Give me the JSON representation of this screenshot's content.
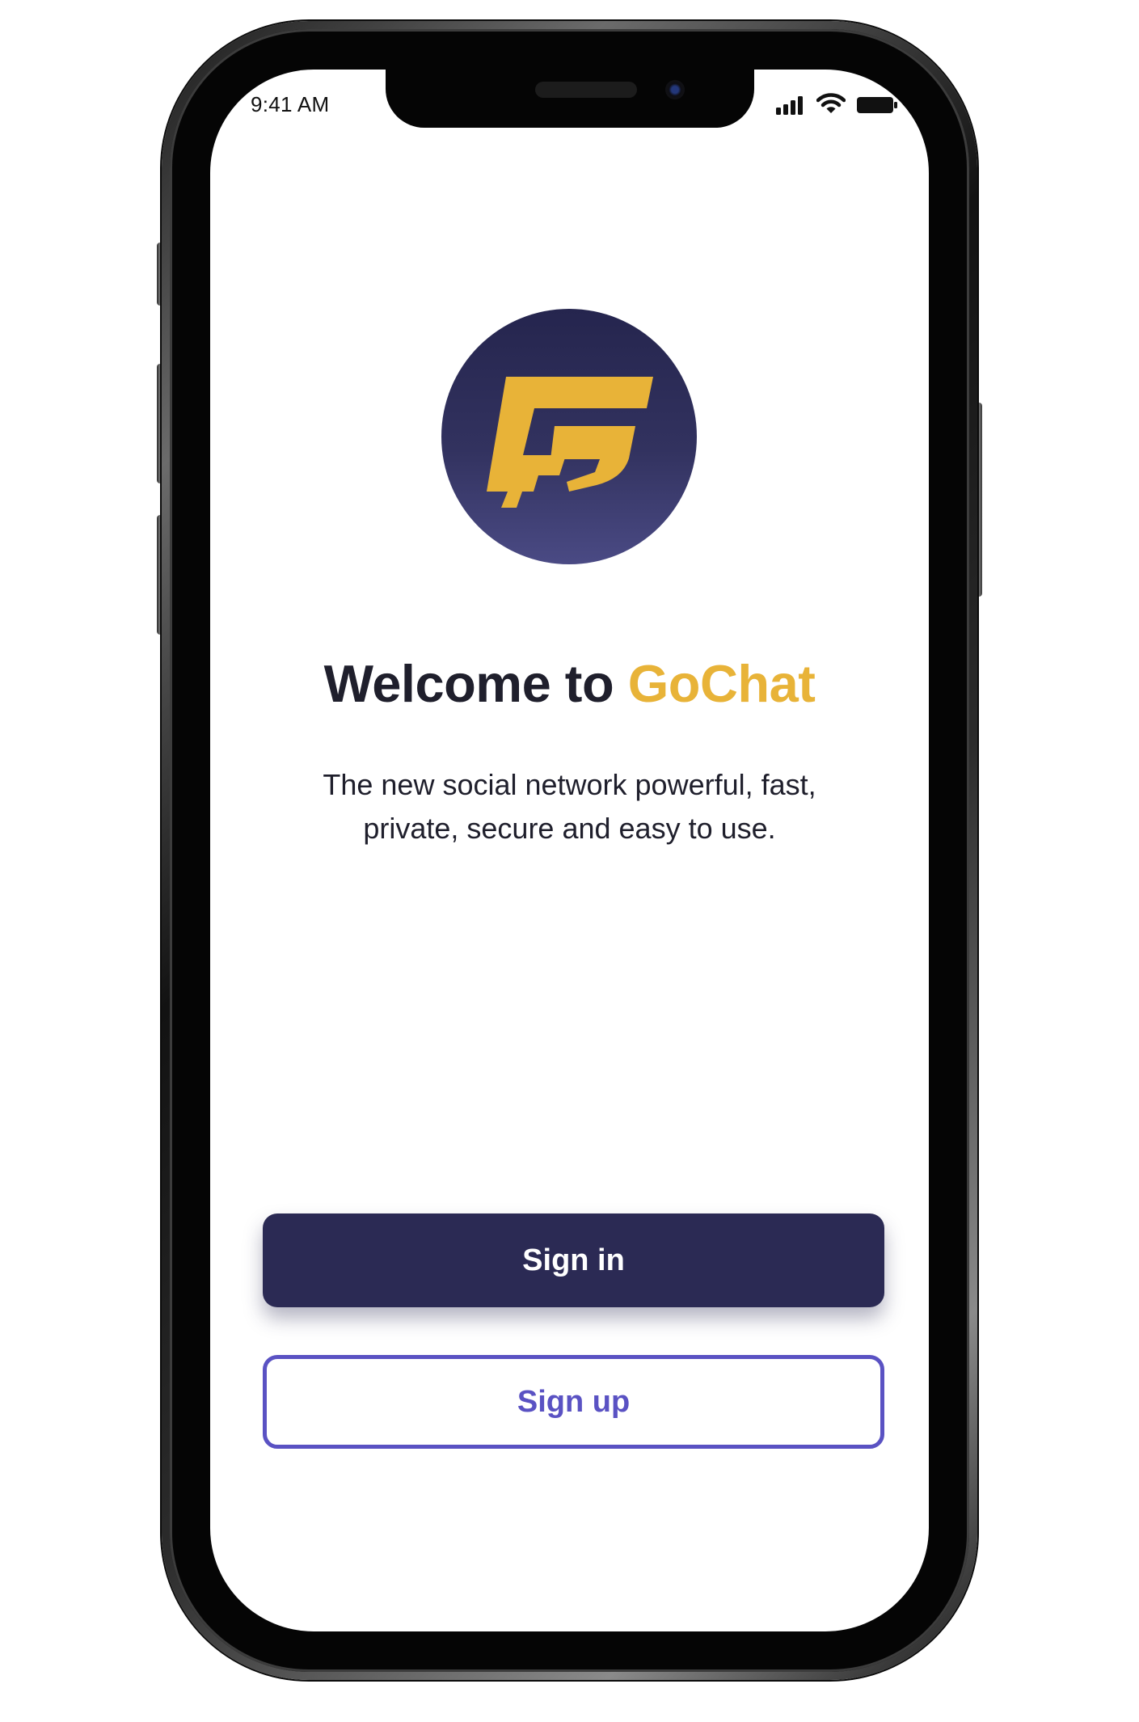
{
  "status_bar": {
    "time": "9:41 AM",
    "icons": [
      "cellular-signal-icon",
      "wifi-icon",
      "battery-icon"
    ]
  },
  "logo": {
    "icon": "gochat-logo-icon",
    "colors": {
      "circle": "#2b2a54",
      "glyph": "#e8b338"
    }
  },
  "welcome": {
    "prefix": "Welcome to",
    "brand": "GoChat"
  },
  "tagline": "The new social network powerful, fast, private, secure and easy to use.",
  "buttons": {
    "sign_in": "Sign in",
    "sign_up": "Sign up"
  },
  "colors": {
    "primary": "#2b2a54",
    "accent": "#5a52c3",
    "brand_yellow": "#e8b338",
    "text": "#1f1f2c"
  }
}
